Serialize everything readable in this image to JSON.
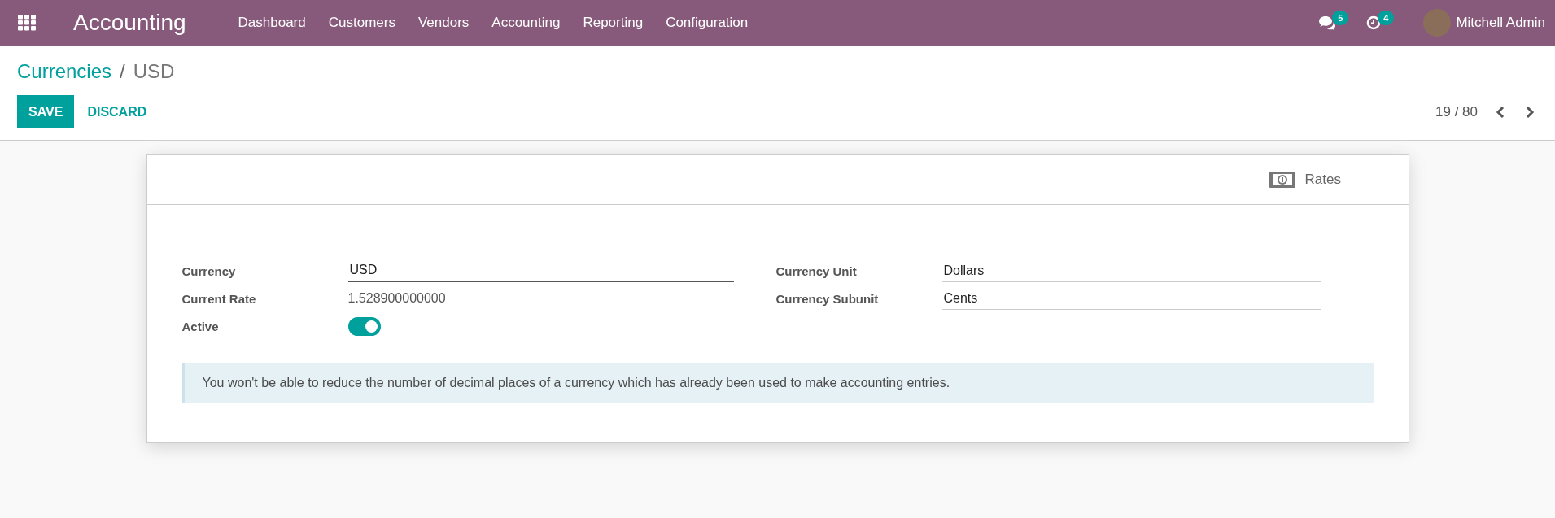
{
  "navbar": {
    "app_title": "Accounting",
    "menu": [
      "Dashboard",
      "Customers",
      "Vendors",
      "Accounting",
      "Reporting",
      "Configuration"
    ],
    "messages_count": "5",
    "activities_count": "4",
    "user": "Mitchell Admin"
  },
  "breadcrumb": {
    "parent": "Currencies",
    "separator": "/",
    "current": "USD"
  },
  "buttons": {
    "save": "SAVE",
    "discard": "DISCARD"
  },
  "pager": {
    "value": "19 / 80"
  },
  "smart_buttons": [
    {
      "label": "Rates"
    }
  ],
  "form": {
    "left": [
      {
        "label": "Currency",
        "kind": "input",
        "value": "USD",
        "focused": true
      },
      {
        "label": "Current Rate",
        "kind": "readonly",
        "value": "1.528900000000"
      },
      {
        "label": "Active",
        "kind": "toggle",
        "on": true
      }
    ],
    "right": [
      {
        "label": "Currency Unit",
        "kind": "input",
        "value": "Dollars",
        "focused": false
      },
      {
        "label": "Currency Subunit",
        "kind": "input",
        "value": "Cents",
        "focused": false
      }
    ]
  },
  "alert": "You won't be able to reduce the number of decimal places of a currency which has already been used to make accounting entries."
}
